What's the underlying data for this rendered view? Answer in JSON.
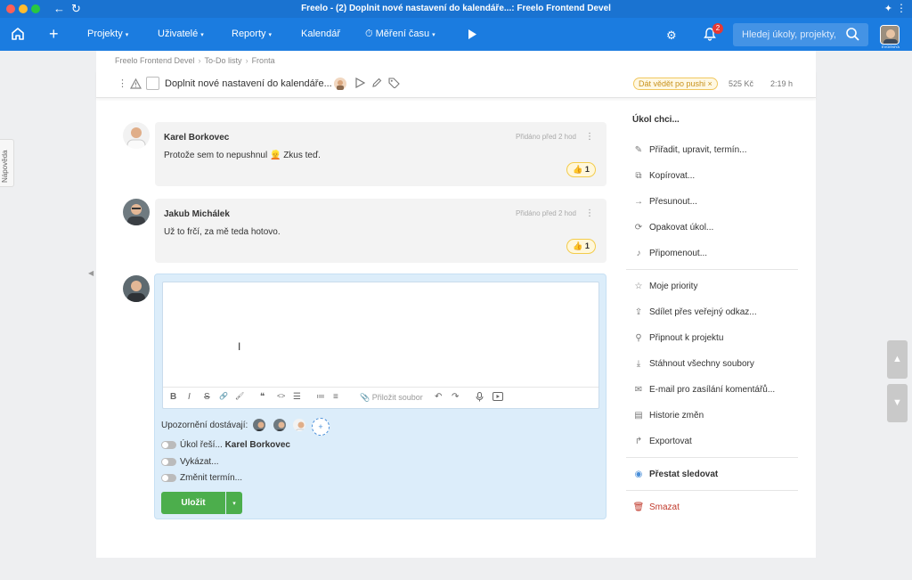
{
  "window": {
    "title": "Freelo - (2) Doplnit nové nastavení do kalendáře...: Freelo Frontend Devel"
  },
  "nav": {
    "items": [
      {
        "label": "Projekty",
        "has_dropdown": true
      },
      {
        "label": "Uživatelé",
        "has_dropdown": true
      },
      {
        "label": "Reporty",
        "has_dropdown": true
      },
      {
        "label": "Kalendář",
        "has_dropdown": false
      },
      {
        "label": "Měření času",
        "has_dropdown": true
      }
    ],
    "notification_count": "2",
    "search_placeholder": "Hledej úkoly, projekty,",
    "user_label": "EVGENIYA"
  },
  "help_tab": "Nápověda",
  "breadcrumb": [
    "Freelo Frontend Devel",
    "To-Do listy",
    "Fronta"
  ],
  "task": {
    "name": "Doplnit nové nastavení do kalendáře...",
    "tag": "Dát vědět po pushi ×",
    "price": "525 Kč",
    "time": "2:19 h"
  },
  "comments": [
    {
      "author": "Karel Borkovec",
      "added": "Přidáno před 2 hod",
      "text": "Protože sem to nepushnul 👱 Zkus teď.",
      "likes": "👍 1"
    },
    {
      "author": "Jakub Michálek",
      "added": "Přidáno před 2 hod",
      "text": "Už to frčí, za mě teda hotovo.",
      "likes": "👍 1"
    }
  ],
  "composer": {
    "toolbar": [
      "B",
      "I",
      "S",
      "🔗",
      "🖌",
      "❝",
      "<>",
      "☰",
      "≔",
      "≡"
    ],
    "attach_label": "📎 Přiložit soubor",
    "notify_label": "Upozornění dostávají:",
    "toggles": [
      {
        "label": "Úkol řeší...",
        "value": "Karel Borkovec"
      },
      {
        "label": "Vykázat...",
        "value": ""
      },
      {
        "label": "Změnit termín...",
        "value": ""
      }
    ],
    "save_label": "Uložit"
  },
  "menu": {
    "heading": "Úkol chci...",
    "items": [
      {
        "label": "Přiřadit, upravit, termín...",
        "icon": "pencil-icon"
      },
      {
        "label": "Kopírovat...",
        "icon": "copy-icon"
      },
      {
        "label": "Přesunout...",
        "icon": "move-icon"
      },
      {
        "label": "Opakovat úkol...",
        "icon": "repeat-icon"
      },
      {
        "label": "Připomenout...",
        "icon": "bell-icon"
      },
      {
        "label": "Moje priority",
        "icon": "star-icon"
      },
      {
        "label": "Sdílet přes veřejný odkaz...",
        "icon": "share-icon"
      },
      {
        "label": "Připnout k projektu",
        "icon": "pin-icon"
      },
      {
        "label": "Stáhnout všechny soubory",
        "icon": "download-icon"
      },
      {
        "label": "E-mail pro zasílání komentářů...",
        "icon": "mail-icon"
      },
      {
        "label": "Historie změn",
        "icon": "history-icon"
      },
      {
        "label": "Exportovat",
        "icon": "export-icon"
      },
      {
        "label": "Přestat sledovat",
        "icon": "eye-icon"
      },
      {
        "label": "Smazat",
        "icon": "trash-icon"
      }
    ]
  },
  "colors": {
    "nav_blue": "#1b7ce0",
    "title_blue": "#1a73d1",
    "save_green": "#4cae4c",
    "composer_bg": "#dcedfa",
    "danger": "#c0392b",
    "tag_yellow": "#f0c75e"
  }
}
